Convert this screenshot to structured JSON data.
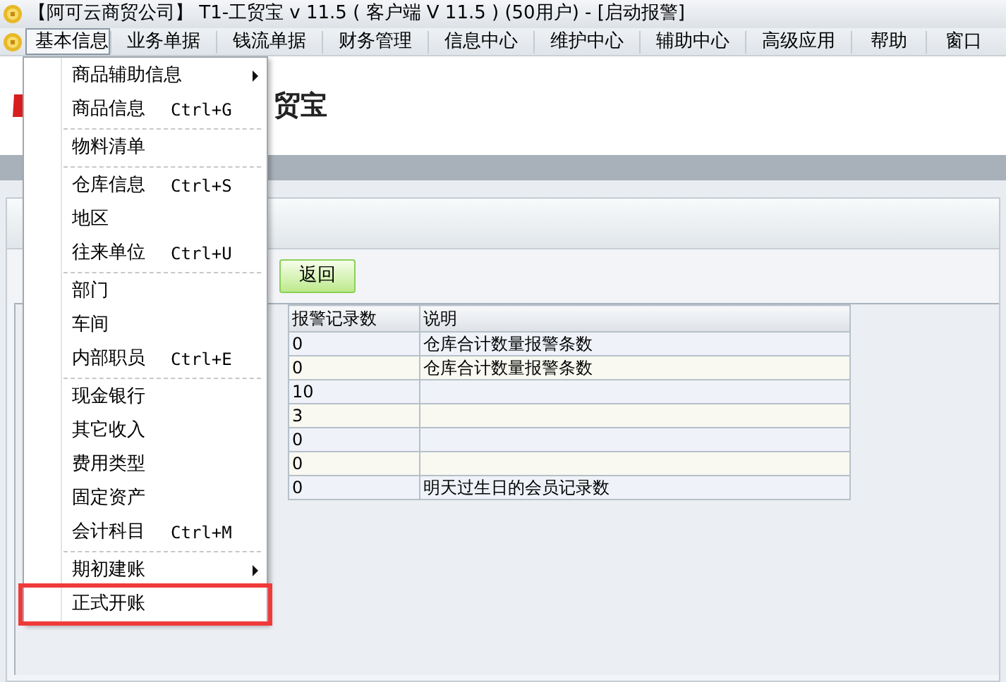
{
  "window": {
    "title": "【阿可云商贸公司】 T1-工贸宝 v 11.5 ( 客户端 V 11.5 ) (50用户) - [启动报警]"
  },
  "menu_bar": [
    {
      "label": "基本信息",
      "selected": true
    },
    {
      "label": "业务单据",
      "selected": false
    },
    {
      "label": "钱流单据",
      "selected": false
    },
    {
      "label": "财务管理",
      "selected": false
    },
    {
      "label": "信息中心",
      "selected": false
    },
    {
      "label": "维护中心",
      "selected": false
    },
    {
      "label": "辅助中心",
      "selected": false
    },
    {
      "label": "高级应用",
      "selected": false
    },
    {
      "label": "帮助",
      "selected": false
    },
    {
      "label": "窗口",
      "selected": false
    }
  ],
  "logo": {
    "text": "贸宝"
  },
  "toolbar": {
    "buttons": [
      "返回"
    ]
  },
  "table": {
    "columns": [
      "报警记录数",
      "说明"
    ],
    "rows": [
      [
        "0",
        "仓库合计数量报警条数"
      ],
      [
        "0",
        "仓库合计数量报警条数"
      ],
      [
        "10",
        ""
      ],
      [
        "3",
        ""
      ],
      [
        "0",
        ""
      ],
      [
        "0",
        ""
      ],
      [
        "0",
        "明天过生日的会员记录数"
      ]
    ]
  },
  "dropdown_menu": [
    {
      "kind": "submenu",
      "label": "商品辅助信息",
      "highlighted": false
    },
    {
      "kind": "item",
      "label": "商品信息",
      "shortcut": "Ctrl+G",
      "highlighted": false
    },
    {
      "kind": "separator"
    },
    {
      "kind": "item",
      "label": "物料清单",
      "highlighted": false
    },
    {
      "kind": "separator"
    },
    {
      "kind": "item",
      "label": "仓库信息",
      "shortcut": "Ctrl+S",
      "highlighted": false
    },
    {
      "kind": "item",
      "label": "地区",
      "highlighted": false
    },
    {
      "kind": "item",
      "label": "往来单位",
      "shortcut": "Ctrl+U",
      "highlighted": false
    },
    {
      "kind": "separator"
    },
    {
      "kind": "item",
      "label": "部门",
      "highlighted": false
    },
    {
      "kind": "item",
      "label": "车间",
      "highlighted": false
    },
    {
      "kind": "item",
      "label": "内部职员",
      "shortcut": "Ctrl+E",
      "highlighted": false
    },
    {
      "kind": "separator"
    },
    {
      "kind": "item",
      "label": "现金银行",
      "highlighted": false
    },
    {
      "kind": "item",
      "label": "其它收入",
      "highlighted": false
    },
    {
      "kind": "item",
      "label": "费用类型",
      "highlighted": false
    },
    {
      "kind": "item",
      "label": "固定资产",
      "highlighted": false
    },
    {
      "kind": "item",
      "label": "会计科目",
      "shortcut": "Ctrl+M",
      "highlighted": false
    },
    {
      "kind": "separator"
    },
    {
      "kind": "submenu",
      "label": "期初建账",
      "highlighted": false
    },
    {
      "kind": "item",
      "label": "正式开账",
      "highlighted": true
    }
  ]
}
